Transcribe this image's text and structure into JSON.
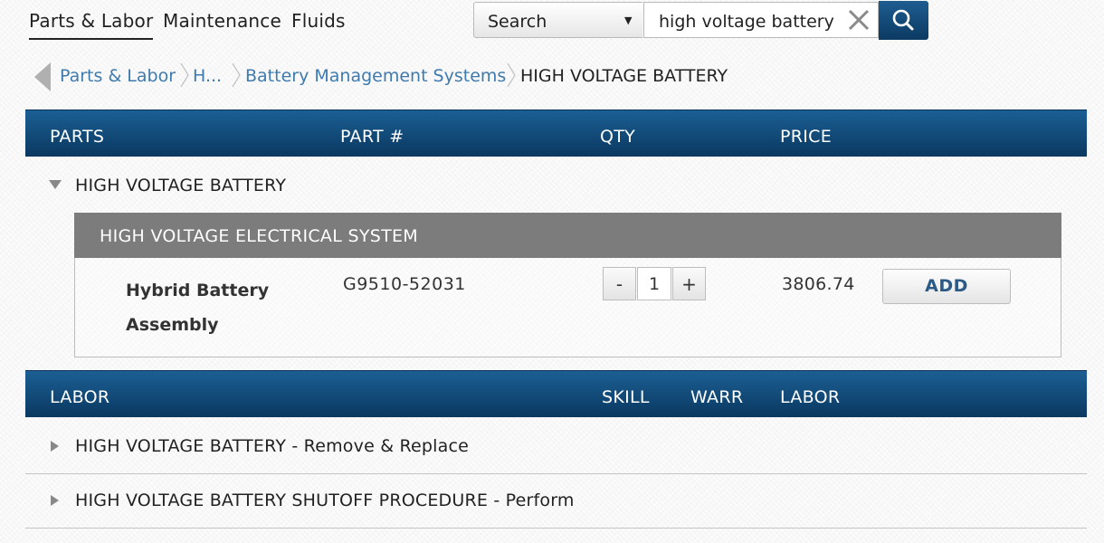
{
  "nav": {
    "tabs": [
      {
        "label": "Parts & Labor",
        "active": true
      },
      {
        "label": "Maintenance",
        "active": false
      },
      {
        "label": "Fluids",
        "active": false
      }
    ]
  },
  "search": {
    "scope_selected": "Search",
    "query": "high voltage battery",
    "icons": {
      "clear": "close-icon",
      "submit": "search-icon"
    }
  },
  "breadcrumb": {
    "back_icon": "back-arrow-icon",
    "items": [
      "Parts & Labor",
      "H...",
      "Battery Management Systems"
    ],
    "current": "HIGH VOLTAGE BATTERY"
  },
  "parts_table": {
    "headers": {
      "parts": "PARTS",
      "part_number": "PART #",
      "qty": "QTY",
      "price": "PRICE"
    },
    "group": {
      "title": "HIGH VOLTAGE BATTERY",
      "expanded": true,
      "subgroup": {
        "title": "HIGH VOLTAGE ELECTRICAL SYSTEM",
        "parts": [
          {
            "name": "Hybrid Battery Assembly",
            "part_number": "G9510-52031",
            "qty": "1",
            "minus_label": "-",
            "plus_label": "+",
            "price": "3806.74",
            "add_label": "ADD"
          }
        ]
      }
    }
  },
  "labor_table": {
    "headers": {
      "labor": "LABOR",
      "skill": "SKILL",
      "warr": "WARR",
      "labor_col": "LABOR"
    },
    "rows": [
      {
        "title": "HIGH VOLTAGE BATTERY - Remove & Replace",
        "expanded": false
      },
      {
        "title": "HIGH VOLTAGE BATTERY SHUTOFF PROCEDURE - Perform",
        "expanded": false
      }
    ]
  },
  "colors": {
    "header_bar": "#0d4270",
    "subgroup_bar": "#7c7c7c",
    "link": "#3f7aae",
    "add_text": "#2c5a86"
  }
}
